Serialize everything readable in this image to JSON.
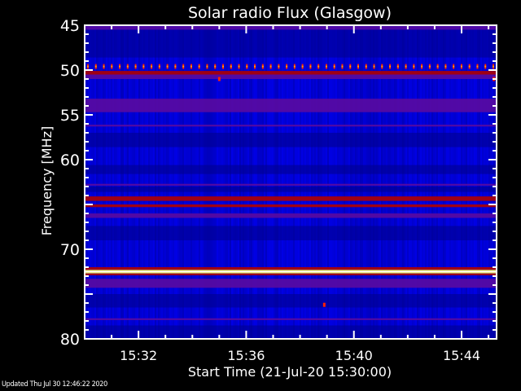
{
  "chart_data": {
    "type": "heatmap",
    "title": "Solar radio Flux (Glasgow)",
    "xlabel": "Start Time (21-Jul-20 15:30:00)",
    "ylabel": "Frequency [MHz]",
    "x_unit": "minutes after 15:30:00",
    "xlim": [
      0,
      15.3
    ],
    "ylim": [
      45,
      80
    ],
    "y_inverted": true,
    "x_ticks": [
      {
        "value": 2,
        "label": "15:32"
      },
      {
        "value": 6,
        "label": "15:36"
      },
      {
        "value": 10,
        "label": "15:40"
      },
      {
        "value": 14,
        "label": "15:44"
      }
    ],
    "y_ticks": [
      {
        "value": 45,
        "label": "45"
      },
      {
        "value": 50,
        "label": "50"
      },
      {
        "value": 55,
        "label": "55"
      },
      {
        "value": 60,
        "label": "60"
      },
      {
        "value": 70,
        "label": "70"
      },
      {
        "value": 80,
        "label": "80"
      }
    ],
    "colors": {
      "background": "#0000e6",
      "low": "#000090",
      "medium": "#5a0aa0",
      "high": "#b00000",
      "very_high": "#ff2000",
      "peak": "#ffff60",
      "max": "#ffffff"
    },
    "bands": [
      {
        "f0": 45.1,
        "f1": 45.5,
        "level": "medium"
      },
      {
        "f0": 45.5,
        "f1": 48.6,
        "level": "low"
      },
      {
        "f0": 50.1,
        "f1": 50.5,
        "level": "high"
      },
      {
        "f0": 50.5,
        "f1": 51.0,
        "level": "medium"
      },
      {
        "f0": 53.2,
        "f1": 54.7,
        "level": "medium"
      },
      {
        "f0": 56.1,
        "f1": 56.3,
        "level": "medium"
      },
      {
        "f0": 57.0,
        "f1": 58.6,
        "level": "low"
      },
      {
        "f0": 60.6,
        "f1": 61.6,
        "level": "low"
      },
      {
        "f0": 62.7,
        "f1": 62.9,
        "level": "medium"
      },
      {
        "f0": 63.0,
        "f1": 63.6,
        "level": "low"
      },
      {
        "f0": 64.1,
        "f1": 64.6,
        "level": "high"
      },
      {
        "f0": 65.0,
        "f1": 65.3,
        "level": "high"
      },
      {
        "f0": 66.0,
        "f1": 66.5,
        "level": "medium"
      },
      {
        "f0": 67.4,
        "f1": 69.0,
        "level": "low"
      },
      {
        "f0": 72.0,
        "f1": 72.3,
        "level": "high"
      },
      {
        "f0": 72.3,
        "f1": 72.7,
        "level": "peak"
      },
      {
        "f0": 72.7,
        "f1": 72.9,
        "level": "high"
      },
      {
        "f0": 73.3,
        "f1": 74.3,
        "level": "medium"
      },
      {
        "f0": 75.0,
        "f1": 76.5,
        "level": "low"
      },
      {
        "f0": 77.7,
        "f1": 77.9,
        "level": "medium"
      },
      {
        "f0": 78.5,
        "f1": 80.0,
        "level": "low"
      }
    ],
    "periodic_bursts": {
      "freq": 49.6,
      "level": "very_high",
      "count": 52
    },
    "spots": [
      {
        "t": 5.0,
        "freq": 51.0,
        "level": "very_high"
      },
      {
        "t": 8.9,
        "freq": 76.2,
        "level": "very_high"
      },
      {
        "t": 15.2,
        "freq": 51.0,
        "level": "very_high"
      }
    ]
  },
  "footer": {
    "updated": "Updated Thu Jul 30 12:46:22 2020"
  }
}
